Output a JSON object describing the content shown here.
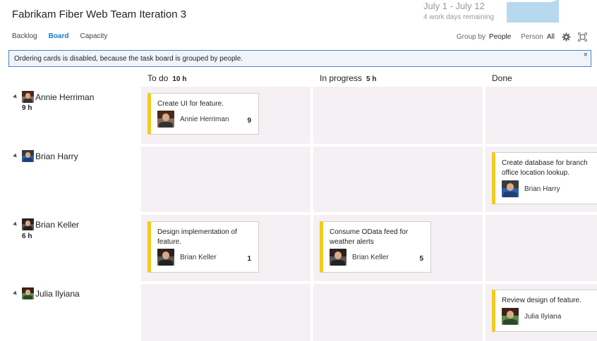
{
  "header": {
    "title": "Fabrikam Fiber Web Team Iteration 3",
    "sprint_dates": "July 1 - July 12",
    "sprint_remaining": "4 work days remaining"
  },
  "nav": {
    "backlog": "Backlog",
    "board": "Board",
    "capacity": "Capacity",
    "active": "Board"
  },
  "toolbar": {
    "group_by_label": "Group by",
    "group_by_value": "People",
    "person_label": "Person",
    "person_value": "All",
    "settings_icon": "gear-icon",
    "fullscreen_icon": "fullscreen-icon"
  },
  "banner": {
    "text": "Ordering cards is disabled, because the task board is grouped by people.",
    "close": "×"
  },
  "columns": [
    {
      "name": "To do",
      "hours": "10 h"
    },
    {
      "name": "In progress",
      "hours": "5 h"
    },
    {
      "name": "Done",
      "hours": ""
    }
  ],
  "rows": [
    {
      "name": "Annie Herriman",
      "hours": "9 h"
    },
    {
      "name": "Brian Harry",
      "hours": ""
    },
    {
      "name": "Brian Keller",
      "hours": "6 h"
    },
    {
      "name": "Julia Ilyiana",
      "hours": ""
    }
  ],
  "cards": [
    {
      "title": "Create UI for feature.",
      "assignee": "Annie Herriman",
      "estimate": "9"
    },
    {
      "title": "Create database for branch office location lookup.",
      "assignee": "Brian Harry",
      "estimate": ""
    },
    {
      "title": "Design implementation of feature.",
      "assignee": "Brian Keller",
      "estimate": "1"
    },
    {
      "title": "Consume OData feed for weather alerts",
      "assignee": "Brian Keller",
      "estimate": "5"
    },
    {
      "title": "Review design of feature.",
      "assignee": "Julia Ilyiana",
      "estimate": ""
    }
  ],
  "colors": {
    "accent": "#1979ca",
    "card_stripe": "#f2cb1d",
    "cell_bg": "#f5f0f4",
    "banner_border": "#4a82c3",
    "burndown": "#b7d9ef"
  }
}
